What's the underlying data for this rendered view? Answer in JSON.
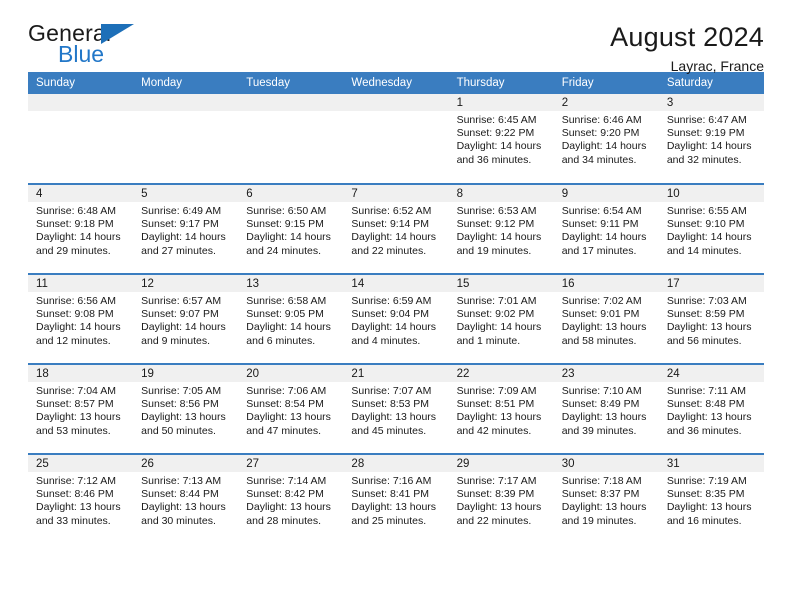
{
  "logo": {
    "word_one": "General",
    "word_two": "Blue",
    "triangle_icon": "triangle-icon"
  },
  "header": {
    "title": "August 2024",
    "subtitle": "Layrac, France"
  },
  "colors": {
    "header_blue": "#3A7DC0",
    "band_gray": "#F0F0F0",
    "logo_blue": "#2277C8",
    "text": "#1A1A1A"
  },
  "calendar": {
    "weekdays": [
      "Sunday",
      "Monday",
      "Tuesday",
      "Wednesday",
      "Thursday",
      "Friday",
      "Saturday"
    ],
    "labels": {
      "sunrise": "Sunrise:",
      "sunset": "Sunset:",
      "daylight": "Daylight:"
    },
    "weeks": [
      [
        {
          "day": "",
          "sunrise": "",
          "sunset": "",
          "daylight": ""
        },
        {
          "day": "",
          "sunrise": "",
          "sunset": "",
          "daylight": ""
        },
        {
          "day": "",
          "sunrise": "",
          "sunset": "",
          "daylight": ""
        },
        {
          "day": "",
          "sunrise": "",
          "sunset": "",
          "daylight": ""
        },
        {
          "day": "1",
          "sunrise": "Sunrise: 6:45 AM",
          "sunset": "Sunset: 9:22 PM",
          "daylight": "Daylight: 14 hours and 36 minutes."
        },
        {
          "day": "2",
          "sunrise": "Sunrise: 6:46 AM",
          "sunset": "Sunset: 9:20 PM",
          "daylight": "Daylight: 14 hours and 34 minutes."
        },
        {
          "day": "3",
          "sunrise": "Sunrise: 6:47 AM",
          "sunset": "Sunset: 9:19 PM",
          "daylight": "Daylight: 14 hours and 32 minutes."
        }
      ],
      [
        {
          "day": "4",
          "sunrise": "Sunrise: 6:48 AM",
          "sunset": "Sunset: 9:18 PM",
          "daylight": "Daylight: 14 hours and 29 minutes."
        },
        {
          "day": "5",
          "sunrise": "Sunrise: 6:49 AM",
          "sunset": "Sunset: 9:17 PM",
          "daylight": "Daylight: 14 hours and 27 minutes."
        },
        {
          "day": "6",
          "sunrise": "Sunrise: 6:50 AM",
          "sunset": "Sunset: 9:15 PM",
          "daylight": "Daylight: 14 hours and 24 minutes."
        },
        {
          "day": "7",
          "sunrise": "Sunrise: 6:52 AM",
          "sunset": "Sunset: 9:14 PM",
          "daylight": "Daylight: 14 hours and 22 minutes."
        },
        {
          "day": "8",
          "sunrise": "Sunrise: 6:53 AM",
          "sunset": "Sunset: 9:12 PM",
          "daylight": "Daylight: 14 hours and 19 minutes."
        },
        {
          "day": "9",
          "sunrise": "Sunrise: 6:54 AM",
          "sunset": "Sunset: 9:11 PM",
          "daylight": "Daylight: 14 hours and 17 minutes."
        },
        {
          "day": "10",
          "sunrise": "Sunrise: 6:55 AM",
          "sunset": "Sunset: 9:10 PM",
          "daylight": "Daylight: 14 hours and 14 minutes."
        }
      ],
      [
        {
          "day": "11",
          "sunrise": "Sunrise: 6:56 AM",
          "sunset": "Sunset: 9:08 PM",
          "daylight": "Daylight: 14 hours and 12 minutes."
        },
        {
          "day": "12",
          "sunrise": "Sunrise: 6:57 AM",
          "sunset": "Sunset: 9:07 PM",
          "daylight": "Daylight: 14 hours and 9 minutes."
        },
        {
          "day": "13",
          "sunrise": "Sunrise: 6:58 AM",
          "sunset": "Sunset: 9:05 PM",
          "daylight": "Daylight: 14 hours and 6 minutes."
        },
        {
          "day": "14",
          "sunrise": "Sunrise: 6:59 AM",
          "sunset": "Sunset: 9:04 PM",
          "daylight": "Daylight: 14 hours and 4 minutes."
        },
        {
          "day": "15",
          "sunrise": "Sunrise: 7:01 AM",
          "sunset": "Sunset: 9:02 PM",
          "daylight": "Daylight: 14 hours and 1 minute."
        },
        {
          "day": "16",
          "sunrise": "Sunrise: 7:02 AM",
          "sunset": "Sunset: 9:01 PM",
          "daylight": "Daylight: 13 hours and 58 minutes."
        },
        {
          "day": "17",
          "sunrise": "Sunrise: 7:03 AM",
          "sunset": "Sunset: 8:59 PM",
          "daylight": "Daylight: 13 hours and 56 minutes."
        }
      ],
      [
        {
          "day": "18",
          "sunrise": "Sunrise: 7:04 AM",
          "sunset": "Sunset: 8:57 PM",
          "daylight": "Daylight: 13 hours and 53 minutes."
        },
        {
          "day": "19",
          "sunrise": "Sunrise: 7:05 AM",
          "sunset": "Sunset: 8:56 PM",
          "daylight": "Daylight: 13 hours and 50 minutes."
        },
        {
          "day": "20",
          "sunrise": "Sunrise: 7:06 AM",
          "sunset": "Sunset: 8:54 PM",
          "daylight": "Daylight: 13 hours and 47 minutes."
        },
        {
          "day": "21",
          "sunrise": "Sunrise: 7:07 AM",
          "sunset": "Sunset: 8:53 PM",
          "daylight": "Daylight: 13 hours and 45 minutes."
        },
        {
          "day": "22",
          "sunrise": "Sunrise: 7:09 AM",
          "sunset": "Sunset: 8:51 PM",
          "daylight": "Daylight: 13 hours and 42 minutes."
        },
        {
          "day": "23",
          "sunrise": "Sunrise: 7:10 AM",
          "sunset": "Sunset: 8:49 PM",
          "daylight": "Daylight: 13 hours and 39 minutes."
        },
        {
          "day": "24",
          "sunrise": "Sunrise: 7:11 AM",
          "sunset": "Sunset: 8:48 PM",
          "daylight": "Daylight: 13 hours and 36 minutes."
        }
      ],
      [
        {
          "day": "25",
          "sunrise": "Sunrise: 7:12 AM",
          "sunset": "Sunset: 8:46 PM",
          "daylight": "Daylight: 13 hours and 33 minutes."
        },
        {
          "day": "26",
          "sunrise": "Sunrise: 7:13 AM",
          "sunset": "Sunset: 8:44 PM",
          "daylight": "Daylight: 13 hours and 30 minutes."
        },
        {
          "day": "27",
          "sunrise": "Sunrise: 7:14 AM",
          "sunset": "Sunset: 8:42 PM",
          "daylight": "Daylight: 13 hours and 28 minutes."
        },
        {
          "day": "28",
          "sunrise": "Sunrise: 7:16 AM",
          "sunset": "Sunset: 8:41 PM",
          "daylight": "Daylight: 13 hours and 25 minutes."
        },
        {
          "day": "29",
          "sunrise": "Sunrise: 7:17 AM",
          "sunset": "Sunset: 8:39 PM",
          "daylight": "Daylight: 13 hours and 22 minutes."
        },
        {
          "day": "30",
          "sunrise": "Sunrise: 7:18 AM",
          "sunset": "Sunset: 8:37 PM",
          "daylight": "Daylight: 13 hours and 19 minutes."
        },
        {
          "day": "31",
          "sunrise": "Sunrise: 7:19 AM",
          "sunset": "Sunset: 8:35 PM",
          "daylight": "Daylight: 13 hours and 16 minutes."
        }
      ]
    ]
  }
}
